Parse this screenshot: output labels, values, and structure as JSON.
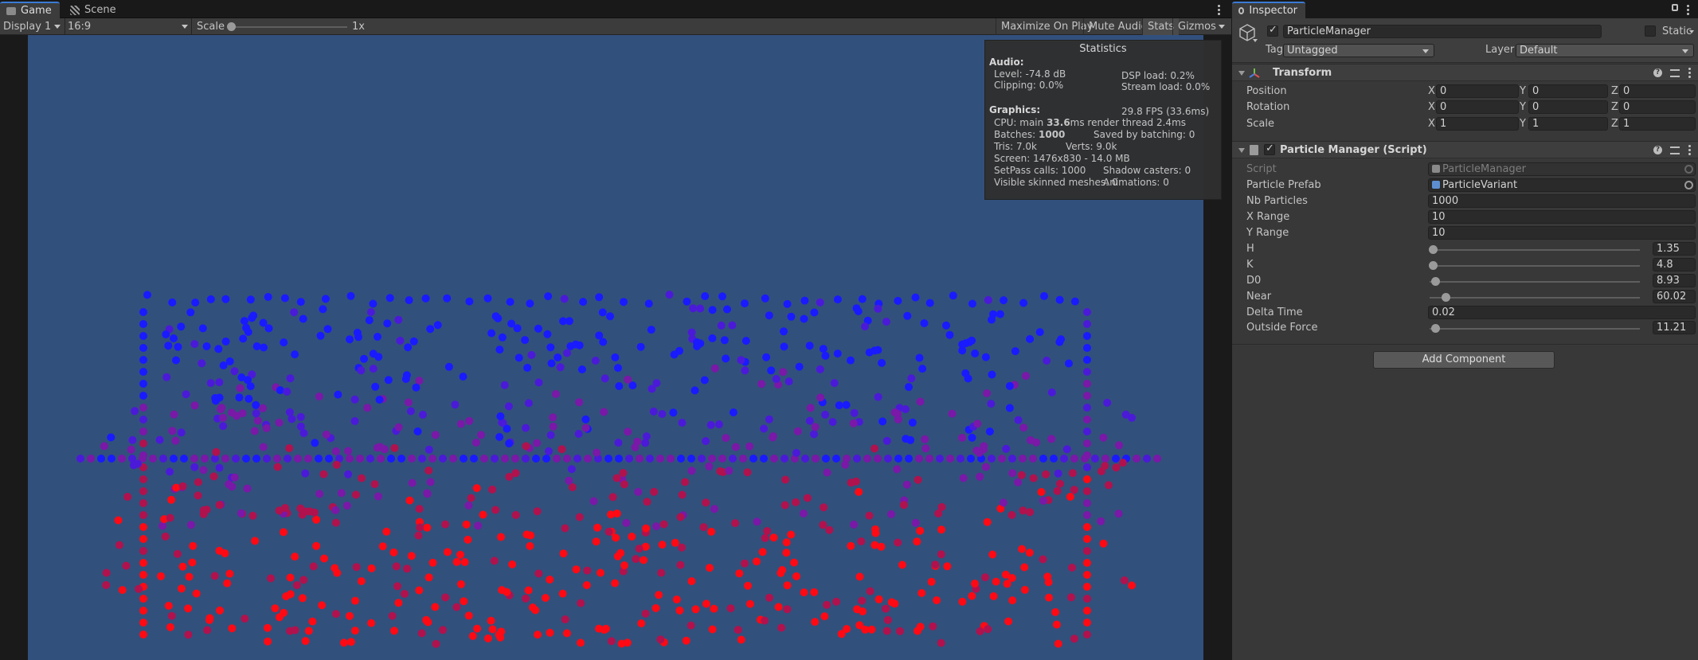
{
  "game_panel": {
    "tabs": [
      {
        "label": "Game",
        "icon": "gamepad-icon",
        "active": true
      },
      {
        "label": "Scene",
        "icon": "scene-grid-icon",
        "active": false
      }
    ],
    "toolbar": {
      "display": "Display 1",
      "aspect": "16:9",
      "scale_label": "Scale",
      "scale_value": "1x",
      "scale_fraction": 0.0,
      "buttons": [
        {
          "label": "Maximize On Play",
          "active": false
        },
        {
          "label": "Mute Audio",
          "active": false
        },
        {
          "label": "Stats",
          "active": true
        },
        {
          "label": "Gizmos",
          "active": false
        }
      ]
    },
    "viewport": {
      "background": "#32507c",
      "particle_colors": [
        "#1a1aff",
        "#4b1ad8",
        "#7a18a8",
        "#b0124e",
        "#ff0a14"
      ]
    },
    "stats": {
      "title": "Statistics",
      "audio_header": "Audio:",
      "level": "Level: -74.8 dB",
      "clipping": "Clipping: 0.0%",
      "dsp": "DSP load: 0.2%",
      "stream": "Stream load: 0.0%",
      "graphics_header": "Graphics:",
      "fps": "29.8 FPS (33.6ms)",
      "cpu_prefix": "CPU: main ",
      "cpu_main": "33.6",
      "cpu_suffix": "ms  render thread 2.4ms",
      "batches_prefix": "Batches: ",
      "batches": "1000",
      "saved_batching": "Saved by batching: 0",
      "tris": "Tris: 7.0k",
      "verts": "Verts: 9.0k",
      "screen": "Screen: 1476x830 - 14.0 MB",
      "setpass": "SetPass calls: 1000",
      "shadow_casters": "Shadow casters: 0",
      "skinned": "Visible skinned meshes: 0",
      "animations": "Animations: 0"
    }
  },
  "inspector": {
    "tab_label": "Inspector",
    "object": {
      "name": "ParticleManager",
      "active": true,
      "static_label": "Static",
      "tag_label": "Tag",
      "tag_value": "Untagged",
      "layer_label": "Layer",
      "layer_value": "Default"
    },
    "transform": {
      "title": "Transform",
      "rows": [
        {
          "label": "Position",
          "x": "0",
          "y": "0",
          "z": "0"
        },
        {
          "label": "Rotation",
          "x": "0",
          "y": "0",
          "z": "0"
        },
        {
          "label": "Scale",
          "x": "1",
          "y": "1",
          "z": "1"
        }
      ],
      "axis_x": "X",
      "axis_y": "Y",
      "axis_z": "Z"
    },
    "particle_manager": {
      "title": "Particle Manager (Script)",
      "enabled": true,
      "script_label": "Script",
      "script_value": "ParticleManager",
      "prefab_label": "Particle Prefab",
      "prefab_value": "ParticleVariant",
      "nb_label": "Nb Particles",
      "nb_value": "1000",
      "xrange_label": "X Range",
      "xrange_value": "10",
      "yrange_label": "Y Range",
      "yrange_value": "10",
      "sliders": [
        {
          "label": "H",
          "value": "1.35",
          "fraction": 0.0
        },
        {
          "label": "K",
          "value": "4.8",
          "fraction": 0.0
        },
        {
          "label": "D0",
          "value": "8.93",
          "fraction": 0.01
        },
        {
          "label": "Near",
          "value": "60.02",
          "fraction": 0.06
        },
        {
          "label": "Outside Force",
          "value": "11.21",
          "fraction": 0.01
        }
      ],
      "delta_label": "Delta Time",
      "delta_value": "0.02"
    },
    "add_component": "Add Component"
  }
}
